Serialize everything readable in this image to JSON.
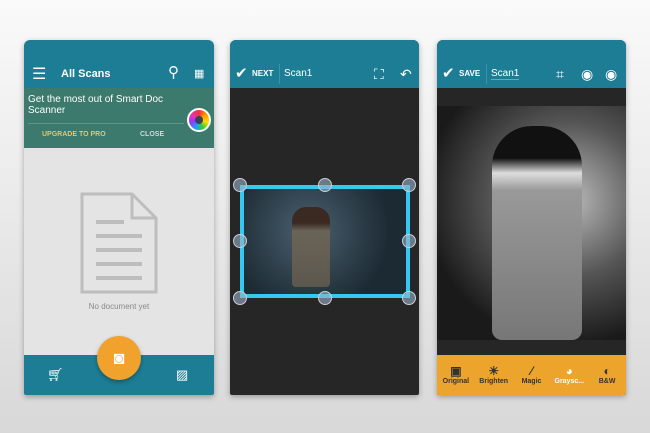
{
  "screen1": {
    "title": "All Scans",
    "banner_text": "Get the most out of Smart Doc Scanner",
    "upgrade_label": "UPGRADE TO PRO",
    "close_label": "CLOSE",
    "empty_text": "No document yet"
  },
  "screen2": {
    "next_label": "NEXT",
    "doc_name": "Scan1"
  },
  "screen3": {
    "save_label": "SAVE",
    "doc_name": "Scan1",
    "filters": [
      {
        "label": "Original",
        "icon": "image-icon"
      },
      {
        "label": "Brighten",
        "icon": "sun-icon"
      },
      {
        "label": "Magic",
        "icon": "magic-wand-icon"
      },
      {
        "label": "Graysc...",
        "icon": "grayscale-icon"
      },
      {
        "label": "B&W",
        "icon": "contrast-icon"
      }
    ],
    "active_filter": "Graysc..."
  },
  "colors": {
    "teal": "#1c7d94",
    "orange": "#eca42c",
    "crop_border": "#35c8f0",
    "banner": "#3b7a6d"
  }
}
